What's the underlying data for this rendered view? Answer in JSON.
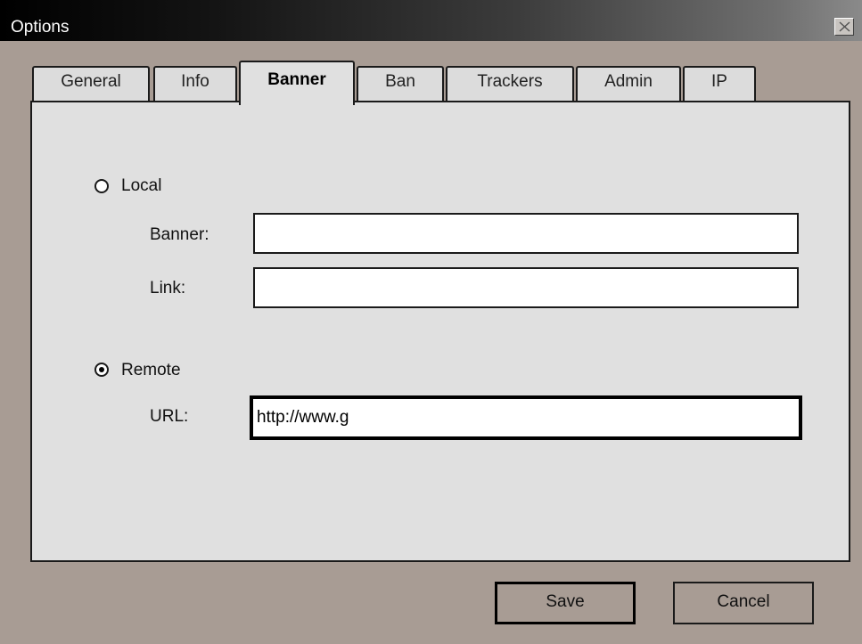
{
  "window": {
    "title": "Options",
    "close_icon": "close-icon"
  },
  "tabs": [
    {
      "label": "General",
      "active": false
    },
    {
      "label": "Info",
      "active": false
    },
    {
      "label": "Banner",
      "active": true
    },
    {
      "label": "Ban",
      "active": false
    },
    {
      "label": "Trackers",
      "active": false
    },
    {
      "label": "Admin",
      "active": false
    },
    {
      "label": "IP",
      "active": false
    }
  ],
  "banner_tab": {
    "local": {
      "label": "Local",
      "selected": false,
      "banner_label": "Banner:",
      "banner_value": "",
      "link_label": "Link:",
      "link_value": ""
    },
    "remote": {
      "label": "Remote",
      "selected": true,
      "url_label": "URL:",
      "url_value": "http://www.g"
    }
  },
  "buttons": {
    "save_label": "Save",
    "cancel_label": "Cancel"
  }
}
